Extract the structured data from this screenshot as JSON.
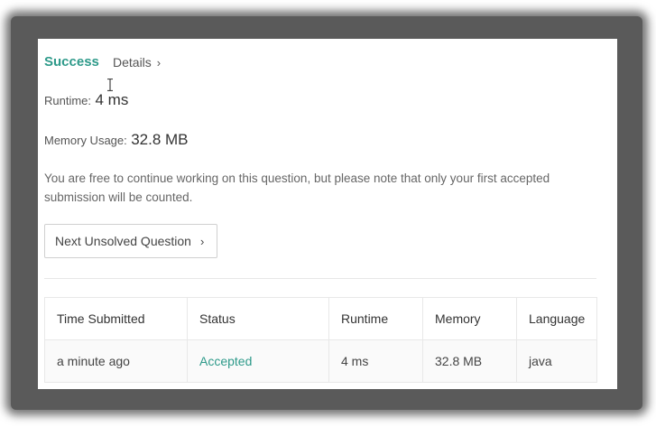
{
  "header": {
    "status_label": "Success",
    "details_label": "Details",
    "details_chevron": "›"
  },
  "stats": {
    "runtime_label": "Runtime:",
    "runtime_value": "4 ms",
    "memory_label": "Memory Usage:",
    "memory_value": "32.8 MB"
  },
  "note": "You are free to continue working on this question, but please note that only your first accepted submission will be counted.",
  "next_button": {
    "label": "Next Unsolved Question",
    "chevron": "›"
  },
  "table": {
    "columns": [
      "Time Submitted",
      "Status",
      "Runtime",
      "Memory",
      "Language"
    ],
    "rows": [
      {
        "time": "a minute ago",
        "status": "Accepted",
        "runtime": "4 ms",
        "memory": "32.8 MB",
        "language": "java"
      }
    ]
  },
  "colors": {
    "accent": "#2e9a8a",
    "text": "#555555",
    "frame": "#5a5a5a"
  },
  "icons": {
    "chevron": "chevron-right-icon",
    "cursor": "text-cursor-icon"
  }
}
